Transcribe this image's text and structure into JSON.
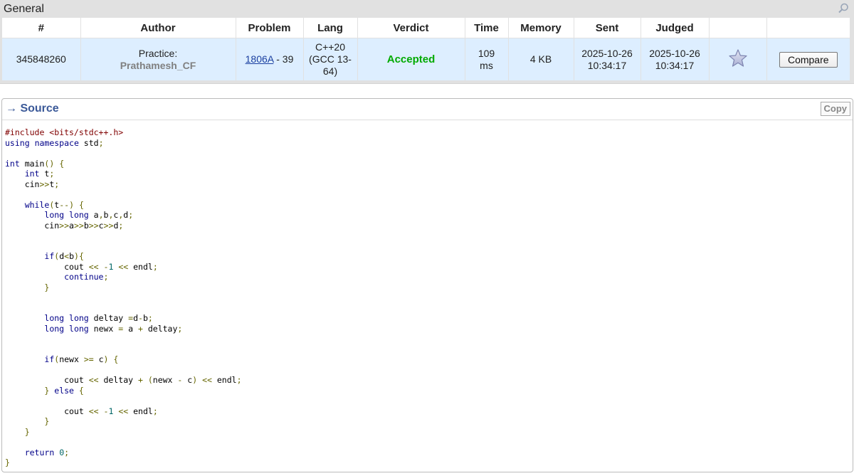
{
  "general": {
    "title": "General",
    "columns": [
      "#",
      "Author",
      "Problem",
      "Lang",
      "Verdict",
      "Time",
      "Memory",
      "Sent",
      "Judged",
      "",
      ""
    ],
    "submission": {
      "id": "345848260",
      "author_type": "Practice:",
      "author_handle": "Prathamesh_CF",
      "problem_code": "1806A",
      "problem_sep": " - ",
      "problem_score": "39",
      "lang": "C++20 (GCC 13-64)",
      "verdict": "Accepted",
      "time": "109 ms",
      "memory": "4 KB",
      "sent": "2025-10-26 10:34:17",
      "judged": "2025-10-26 10:34:17",
      "compare_label": "Compare"
    },
    "icons": {
      "zoom": "magnifier-icon",
      "star": "star-icon"
    },
    "colors": {
      "header_bg": "#e1e1e1",
      "row_bg": "#ddeeff",
      "verdict_accepted": "#00aa00",
      "link": "#1a3fa0"
    }
  },
  "source": {
    "title": "→ Source",
    "copy_label": "Copy",
    "code_lines": [
      "#include <bits/stdc++.h>",
      "using namespace std;",
      "",
      "int main() {",
      "    int t;",
      "    cin>>t;",
      "",
      "    while(t--) {",
      "        long long a,b,c,d;",
      "        cin>>a>>b>>c>>d;",
      "",
      "",
      "        if(d<b){",
      "            cout << -1 << endl;",
      "            continue;",
      "        }",
      "",
      "",
      "        long long deltay =d-b;",
      "        long long newx = a + deltay;",
      "",
      "",
      "        if(newx >= c) {",
      "",
      "            cout << deltay + (newx - c) << endl;",
      "        } else {",
      "",
      "            cout << -1 << endl;",
      "        }",
      "    }",
      "",
      "    return 0;",
      "}"
    ]
  }
}
